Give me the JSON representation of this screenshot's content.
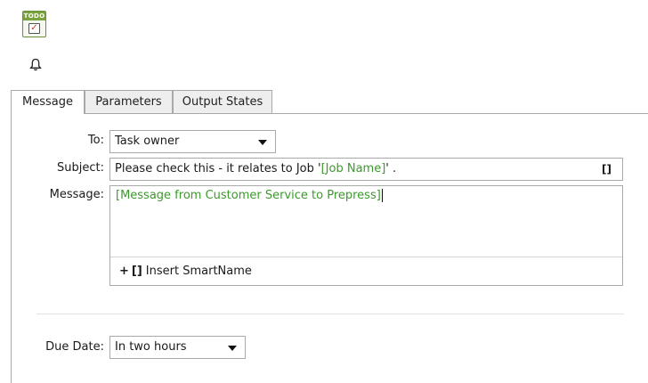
{
  "header": {
    "todo_badge": "TODO",
    "todo_check": "✓"
  },
  "tabs": [
    {
      "label": "Message",
      "active": true
    },
    {
      "label": "Parameters",
      "active": false
    },
    {
      "label": "Output States",
      "active": false
    }
  ],
  "form": {
    "to_label": "To:",
    "to_value": "Task owner",
    "subject_label": "Subject:",
    "subject_prefix": "Please check this - it relates to Job '",
    "subject_smartname": "[Job Name]",
    "subject_suffix": "' .",
    "smartname_button": "[]",
    "message_label": "Message:",
    "message_value": "[Message from Customer Service to Prepress]",
    "insert_plus": "+",
    "insert_brackets": "[]",
    "insert_label": "Insert SmartName",
    "due_label": "Due Date:",
    "due_value": "In two hours"
  },
  "colors": {
    "smartname_text": "#3a9a2a",
    "todo_green": "#7aa23f",
    "border": "#a9a9a9"
  },
  "icons": [
    "todo-task-icon",
    "bell-icon",
    "dropdown-arrow-icon",
    "smartname-icon"
  ]
}
